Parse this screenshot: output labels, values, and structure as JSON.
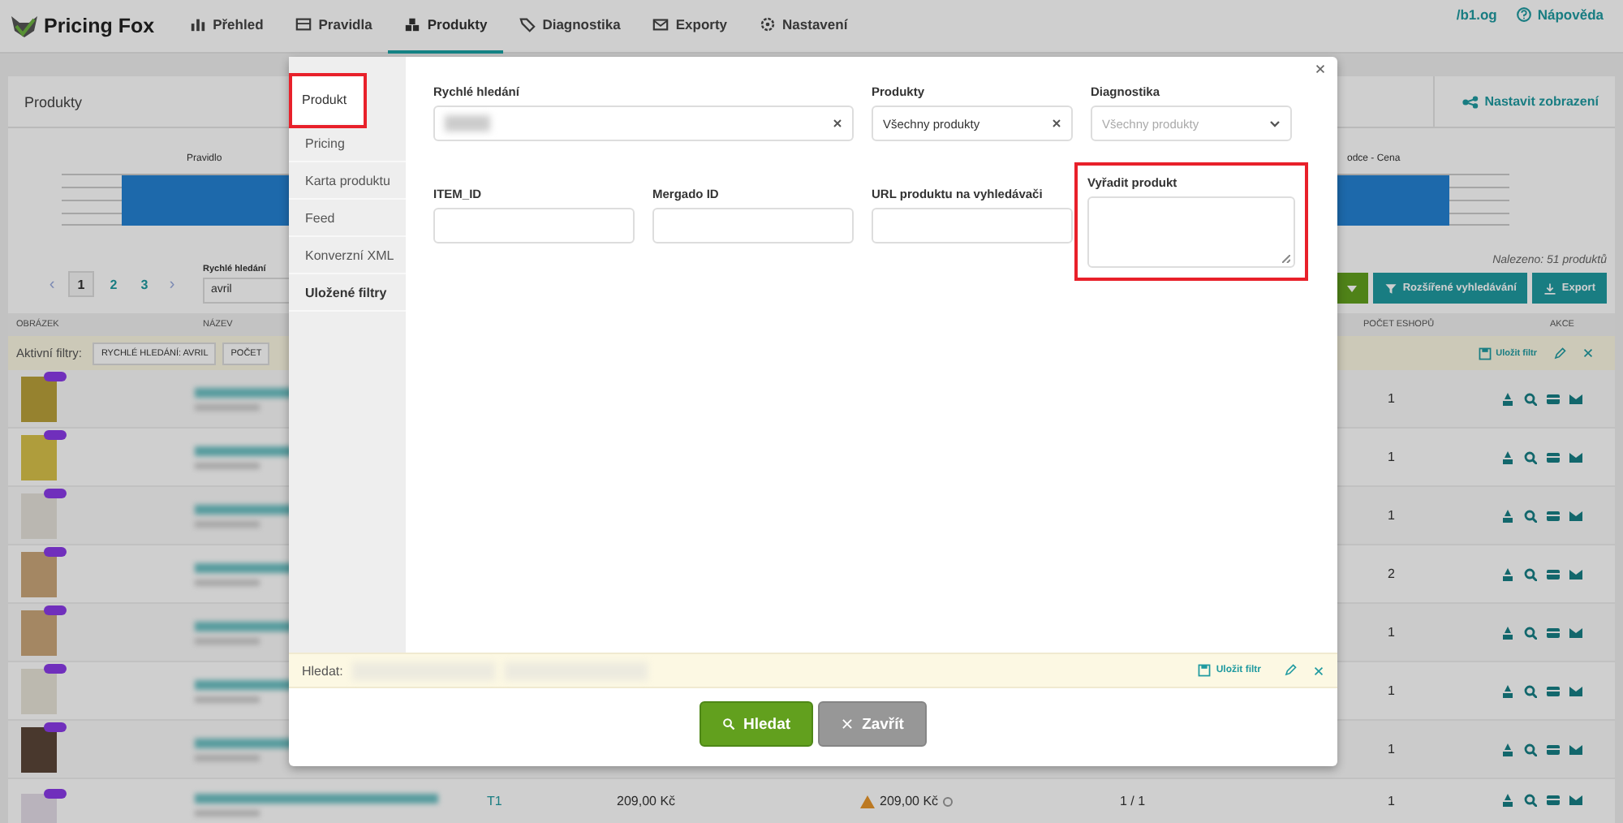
{
  "nav": {
    "brand": "Pricing Fox",
    "items": [
      {
        "label": "Přehled",
        "selected": false
      },
      {
        "label": "Pravidla",
        "selected": false
      },
      {
        "label": "Produkty",
        "selected": true
      },
      {
        "label": "Diagnostika",
        "selected": false
      },
      {
        "label": "Exporty",
        "selected": false
      },
      {
        "label": "Nastavení",
        "selected": false
      }
    ],
    "links": [
      "/b1.og",
      "Nápověda"
    ]
  },
  "products_card": {
    "title": "Produkty",
    "settings_button": "Nastavit zobrazení",
    "chart_labels": [
      "Pravidlo",
      "odce - Cena"
    ],
    "pagination": {
      "prev": "‹",
      "next": "›",
      "pages": [
        {
          "label": "1",
          "selected": true
        },
        {
          "label": "2",
          "selected": false
        },
        {
          "label": "3",
          "selected": false
        }
      ]
    },
    "quick_search": {
      "label": "Rychlé hledání",
      "value": "avril"
    },
    "found": "Nalezeno: 51 produktů",
    "buttons": [
      "Rozšířené vyhledávání",
      "Export"
    ],
    "columns": [
      "OBRÁZEK",
      "NÁZEV",
      "POČET ESHOPŮ",
      "AKCE"
    ],
    "active_filters": {
      "label": "Aktivní filtry:",
      "chips": [
        "RYCHLÉ HLEDÁNÍ: AVRIL",
        "POČET"
      ],
      "save": "Uložit filtr"
    },
    "rows": [
      {
        "count": "1"
      },
      {
        "count": "1"
      },
      {
        "count": "1"
      },
      {
        "count": "2"
      },
      {
        "count": "1"
      },
      {
        "count": "1"
      },
      {
        "count": "1"
      },
      {
        "count": "1",
        "code": "T1",
        "price": "209,00 Kč",
        "price_check": "209,00 Kč",
        "ratio": "1 / 1"
      }
    ]
  },
  "modal": {
    "tabs": [
      {
        "label": "Produkt",
        "selected": true,
        "emphasized": false,
        "highlighted": true
      },
      {
        "label": "Pricing",
        "selected": false,
        "emphasized": false,
        "highlighted": false
      },
      {
        "label": "Karta produktu",
        "selected": false,
        "emphasized": false,
        "highlighted": false
      },
      {
        "label": "Feed",
        "selected": false,
        "emphasized": false,
        "highlighted": false
      },
      {
        "label": "Konverzní XML",
        "selected": false,
        "emphasized": false,
        "highlighted": false
      },
      {
        "label": "Uložené filtry",
        "selected": false,
        "emphasized": true,
        "highlighted": false
      }
    ],
    "fields": [
      {
        "kind": "blurred",
        "label": "Rychlé hledání",
        "highlighted": false
      },
      {
        "kind": "select",
        "label": "Produkty",
        "value": "Všechny produkty",
        "highlighted": false
      },
      {
        "kind": "dropdown",
        "label": "Diagnostika",
        "placeholder": "Všechny produkty",
        "highlighted": false
      },
      {
        "kind": "text",
        "label": "ITEM_ID",
        "highlighted": false
      },
      {
        "kind": "text",
        "label": "Mergado ID",
        "highlighted": false
      },
      {
        "kind": "text",
        "label": "URL produktu na vyhledávači",
        "highlighted": false
      },
      {
        "kind": "textarea",
        "label": "Vyřadit produkt",
        "highlighted": true
      }
    ],
    "search_bar": {
      "label": "Hledat:",
      "save": "Uložit filtr"
    },
    "buttons": [
      {
        "kind": "primary",
        "label": "Hledat"
      },
      {
        "kind": "secondary",
        "label": "Zavřít"
      }
    ]
  }
}
